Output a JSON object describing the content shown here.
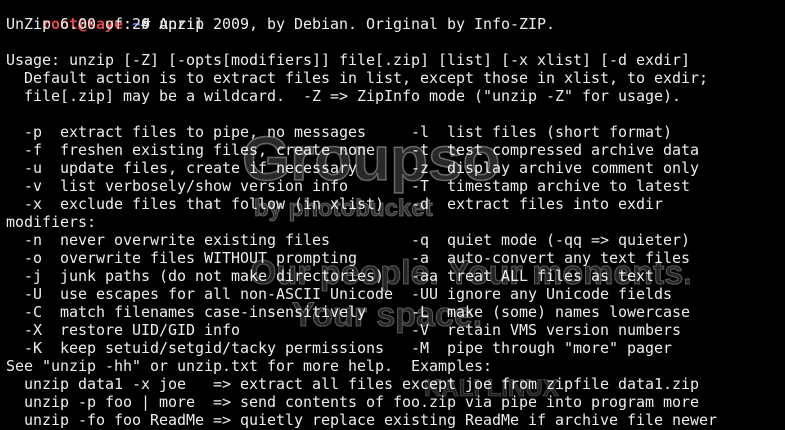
{
  "terminal": {
    "prompt": {
      "user_host": "root@saye",
      "separator": ":",
      "path": "~",
      "symbol": "#",
      "command": " unzip"
    },
    "lines": [
      "UnZip 6.00 of 20 April 2009, by Debian. Original by Info-ZIP.",
      "",
      "Usage: unzip [-Z] [-opts[modifiers]] file[.zip] [list] [-x xlist] [-d exdir]",
      "  Default action is to extract files in list, except those in xlist, to exdir;",
      "  file[.zip] may be a wildcard.  -Z => ZipInfo mode (\"unzip -Z\" for usage).",
      "",
      "  -p  extract files to pipe, no messages     -l  list files (short format)",
      "  -f  freshen existing files, create none    -t  test compressed archive data",
      "  -u  update files, create if necessary      -z  display archive comment only",
      "  -v  list verbosely/show version info       -T  timestamp archive to latest",
      "  -x  exclude files that follow (in xlist)   -d  extract files into exdir",
      "modifiers:",
      "  -n  never overwrite existing files         -q  quiet mode (-qq => quieter)",
      "  -o  overwrite files WITHOUT prompting      -a  auto-convert any text files",
      "  -j  junk paths (do not make directories)   -aa treat ALL files as text",
      "  -U  use escapes for all non-ASCII Unicode  -UU ignore any Unicode fields",
      "  -C  match filenames case-insensitively     -L  make (some) names lowercase",
      "  -X  restore UID/GID info                   -V  retain VMS version numbers",
      "  -K  keep setuid/setgid/tacky permissions   -M  pipe through \"more\" pager",
      "See \"unzip -hh\" or unzip.txt for more help.  Examples:",
      "  unzip data1 -x joe   => extract all files except joe from zipfile data1.zip",
      "  unzip -p foo | more  => send contents of foo.zip via pipe into program more",
      "  unzip -fo foo ReadMe => quietly replace existing ReadMe if archive file newer"
    ]
  },
  "watermark": {
    "logo": "Groupso",
    "by": "by photobucket",
    "caption_1": "Our people. Your moments.",
    "caption_2": "Your space.",
    "footer": "KALI LINUX"
  },
  "colors": {
    "background": "#000000",
    "text": "#ededed",
    "prompt_user": "#e04848",
    "prompt_path": "#5c7cfa"
  }
}
